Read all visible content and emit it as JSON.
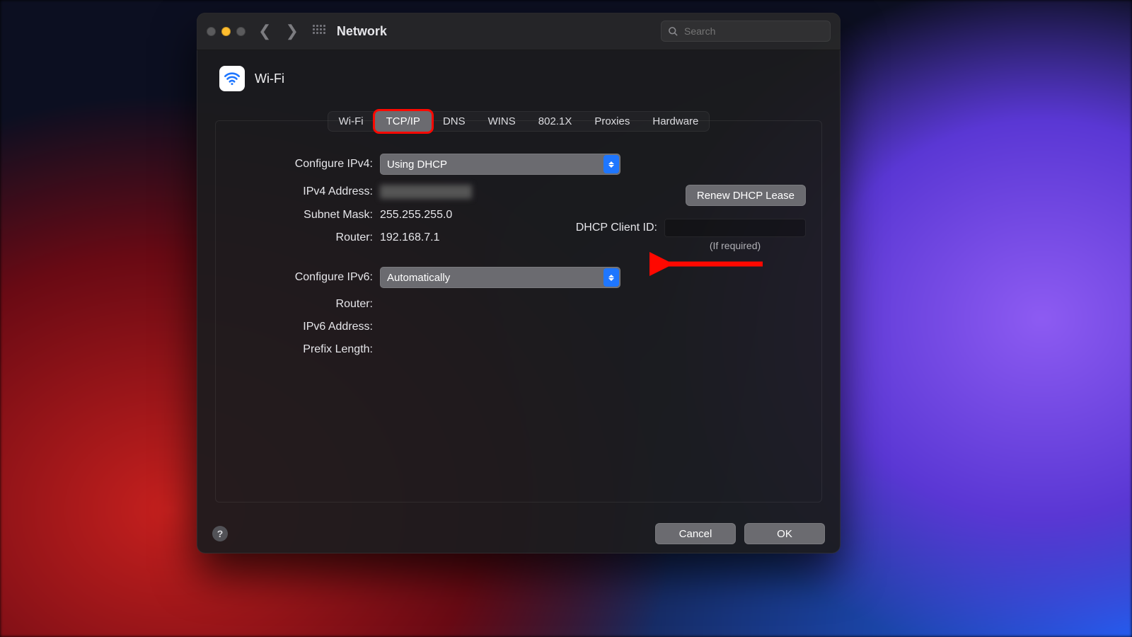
{
  "titlebar": {
    "title": "Network",
    "search_placeholder": "Search"
  },
  "section": {
    "title": "Wi-Fi"
  },
  "tabs": [
    "Wi-Fi",
    "TCP/IP",
    "DNS",
    "WINS",
    "802.1X",
    "Proxies",
    "Hardware"
  ],
  "active_tab_index": 1,
  "form": {
    "configure_ipv4_label": "Configure IPv4:",
    "configure_ipv4_value": "Using DHCP",
    "ipv4_address_label": "IPv4 Address:",
    "subnet_mask_label": "Subnet Mask:",
    "subnet_mask_value": "255.255.255.0",
    "router_label": "Router:",
    "router_value": "192.168.7.1",
    "configure_ipv6_label": "Configure IPv6:",
    "configure_ipv6_value": "Automatically",
    "router6_label": "Router:",
    "ipv6_address_label": "IPv6 Address:",
    "prefix_length_label": "Prefix Length:",
    "renew_label": "Renew DHCP Lease",
    "dhcp_client_id_label": "DHCP Client ID:",
    "dhcp_hint": "(If required)"
  },
  "footer": {
    "cancel": "Cancel",
    "ok": "OK"
  }
}
